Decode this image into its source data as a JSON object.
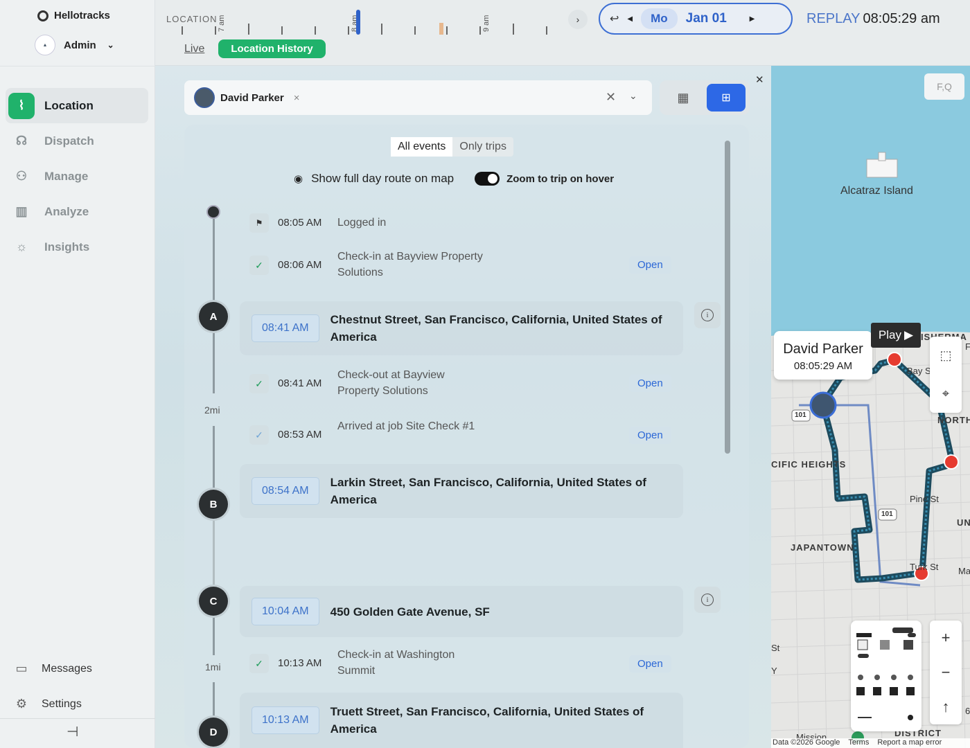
{
  "sidebar": {
    "brand": "Hellotracks",
    "user": "Admin",
    "items": [
      {
        "label": "Location",
        "icon": "route-icon",
        "active": true
      },
      {
        "label": "Dispatch",
        "icon": "dispatch-icon",
        "active": false
      },
      {
        "label": "Manage",
        "icon": "manage-icon",
        "active": false
      },
      {
        "label": "Analyze",
        "icon": "chart-icon",
        "active": false
      },
      {
        "label": "Insights",
        "icon": "lightbulb-icon",
        "active": false
      }
    ],
    "bottom": [
      {
        "label": "Messages",
        "icon": "chat-icon"
      },
      {
        "label": "Settings",
        "icon": "gear-icon"
      }
    ]
  },
  "topbar": {
    "timeline_label": "LOCATION",
    "hours": [
      "7 am",
      "8 am",
      "9 am"
    ],
    "tab_live": "Live",
    "tab_history": "Location History",
    "day": "Mo",
    "date": "Jan 01",
    "replay_label": "REPLAY",
    "replay_time": "08:05:29 am"
  },
  "person_select": {
    "name": "David Parker"
  },
  "filters": {
    "all_events": "All events",
    "only_trips": "Only trips",
    "show_route": "Show full day route on map",
    "zoom_toggle": "Zoom to trip on hover",
    "zoom_toggle_on": true
  },
  "events": [
    {
      "time": "08:05 AM",
      "text": "Logged in",
      "type": "login"
    },
    {
      "time": "08:06 AM",
      "text": "Check-in at Bayview Property Solutions",
      "type": "checkin",
      "action": "Open"
    },
    {
      "time": "08:41 AM",
      "text": "Check-out at Bayview Property Solutions",
      "type": "checkout",
      "action": "Open"
    },
    {
      "time": "08:53 AM",
      "text": "Arrived at job Site Check #1",
      "type": "arrived",
      "action": "Open"
    },
    {
      "time": "10:13 AM",
      "text": "Check-in at Washington Summit",
      "type": "checkin",
      "action": "Open"
    }
  ],
  "trips": [
    {
      "stop": "A",
      "time": "08:41 AM",
      "address": "Chestnut Street, San Francisco, California, United States of America"
    },
    {
      "stop": "B",
      "time": "08:54 AM",
      "address": "Larkin Street, San Francisco, California, United States of America"
    },
    {
      "stop": "C",
      "time": "10:04 AM",
      "address": "450 Golden Gate Avenue, SF"
    },
    {
      "stop": "D",
      "time": "10:13 AM",
      "address": "Truett Street, San Francisco, California, United States of America"
    }
  ],
  "distances": [
    "2mi",
    "1mi"
  ],
  "map": {
    "search_placeholder": "F,Q",
    "popup_name": "David Parker",
    "popup_time": "08:05:29 AM",
    "play_label": "Play",
    "labels": {
      "alcatraz": "Alcatraz Island",
      "fisherman": "FISHERMA",
      "north": "NORTH",
      "pacific": "CIFIC HEIGHTS",
      "japantown": "JAPANTOWN",
      "uni": "UNI",
      "bay": "Bay S",
      "pine": "Pine St",
      "turk": "Turk St",
      "district": "DISTRICT",
      "mission": "Mission",
      "hwy": "101",
      "st": "St",
      "y": "Y",
      "f": "F",
      "g": "6",
      "ma": "Ma"
    },
    "footer_data": "Data ©2026 Google",
    "footer_terms": "Terms",
    "footer_report": "Report a map error"
  },
  "colors": {
    "accent_green": "#20b26b",
    "accent_blue": "#2d68e6",
    "route": "#1d4b5e"
  }
}
